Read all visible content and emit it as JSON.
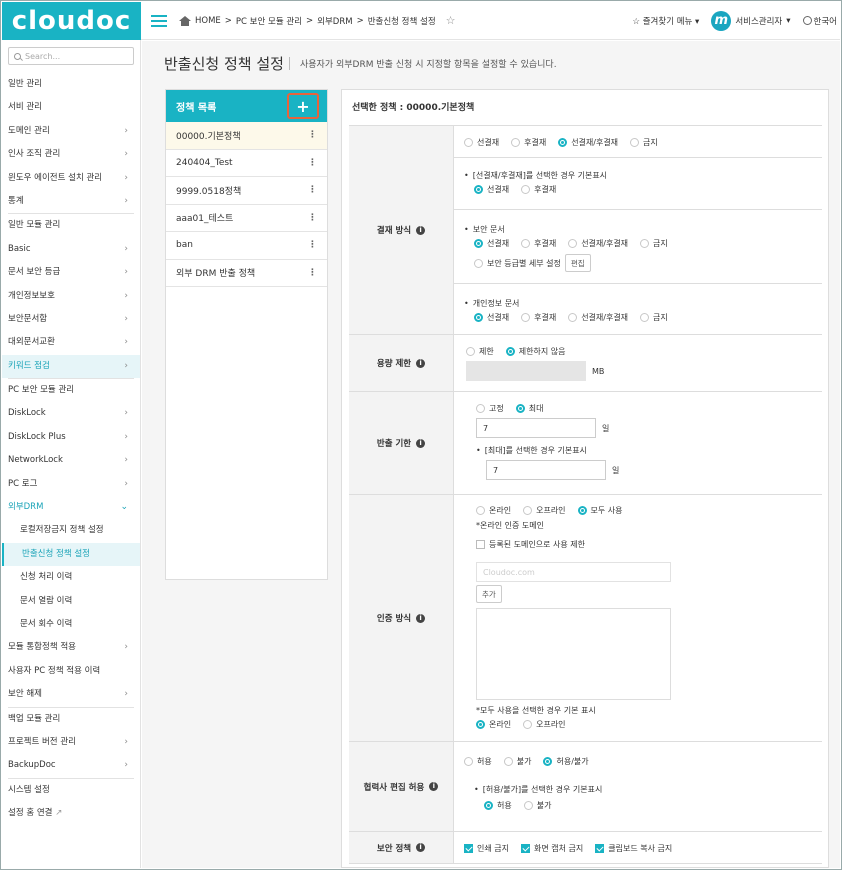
{
  "app": {
    "logo": "cloudoc"
  },
  "header": {
    "breadcrumb": [
      "HOME",
      ">",
      "PC 보안 모듈 관리",
      ">",
      "외부DRM",
      ">",
      "반출신청 정책 설정"
    ],
    "favorites": "즐겨찾기 메뉴",
    "avatar_letter": "m",
    "user": "서비스관리자",
    "language": "한국어"
  },
  "sidebar": {
    "search_placeholder": "Search...",
    "sections": [
      {
        "title": "일반 관리",
        "items": [
          "서비 관리",
          "도메인 관리",
          "인사 조직 관리",
          "윈도우 에이전트 설치 관리",
          "통계"
        ]
      },
      {
        "title": "일반 모듈 관리",
        "items": [
          "Basic",
          "문서 보안 등급",
          "개인정보보호",
          "보안문서함",
          "대외문서교환",
          "키워드 점검"
        ]
      },
      {
        "title": "PC 보안 모듈 관리",
        "items": [
          "DiskLock",
          "DiskLock Plus",
          "NetworkLock",
          "PC 로그",
          "외부DRM"
        ],
        "subitems": [
          "로컬저장금지 정책 설정",
          "반출신청 정책 설정",
          "신청 처리 이력",
          "문서 열람 이력",
          "문서 회수 이력"
        ],
        "items_after": [
          "모듈 통합정책 적용",
          "사용자 PC 정책 적용 이력",
          "보안 해제"
        ]
      },
      {
        "title": "백업 모듈 관리",
        "items": [
          "프로젝트 버전 관리",
          "BackupDoc"
        ]
      },
      {
        "title": "시스템 설정",
        "items": [
          "설정 홈 연결"
        ]
      }
    ]
  },
  "page": {
    "title": "반출신청 정책 설정",
    "subtitle": "사용자가 외부DRM 반출 신청 시 지정할 항목을 설정할 수 있습니다."
  },
  "policy_list": {
    "header": "정책 목록",
    "add_icon": "+",
    "items": [
      "00000.기본정책",
      "240404_Test",
      "9999.0518정책",
      "aaa01_테스트",
      "ban",
      "외부 DRM 반출 정책"
    ]
  },
  "selected": {
    "label": "선택한 정책 : 00000.기본정책"
  },
  "form": {
    "payment": {
      "label": "결재 방식",
      "options": [
        "선결재",
        "후결재",
        "선결재/후결재",
        "금지"
      ],
      "default_label": "[선결재/후결재]를 선택한 경우 기본표시",
      "default_options": [
        "선결재",
        "후결재"
      ],
      "secure_doc": "보안 문서",
      "secure_options": [
        "선결재",
        "후결재",
        "선결재/후결재",
        "금지"
      ],
      "grade_setting": "보안 등급별 세부 설정",
      "edit": "편집",
      "privacy_doc": "개인정보 문서",
      "privacy_options": [
        "선결재",
        "후결재",
        "선결재/후결재",
        "금지"
      ]
    },
    "capacity": {
      "label": "용량 제한",
      "options": [
        "제한",
        "제한하지 않음"
      ],
      "unit": "MB"
    },
    "period": {
      "label": "반출 기한",
      "options": [
        "고정",
        "최대"
      ],
      "value": "7",
      "unit": "일",
      "default_label": "[최대]를 선택한 경우 기본표시",
      "default_value": "7"
    },
    "auth": {
      "label": "인증 방식",
      "options": [
        "온라인",
        "오프라인",
        "모두 사용"
      ],
      "domain_title": "*온라인 인증 도메인",
      "domain_check": "등록된 도메인으로 사용 제한",
      "domain_placeholder": "Cloudoc.com",
      "add": "추가",
      "default_label": "*모두 사용을 선택한 경우 기본 표시",
      "default_options": [
        "온라인",
        "오프라인"
      ]
    },
    "partner": {
      "label": "협력사 편집 허용",
      "options": [
        "허용",
        "불가",
        "허용/불가"
      ],
      "default_label": "[허용/불가]를 선택한 경우 기본표시",
      "default_options": [
        "허용",
        "불가"
      ]
    },
    "security": {
      "label": "보안 정책",
      "checks": [
        "인쇄 금지",
        "화면 캡처 금지",
        "클립보드 복사 금지"
      ]
    }
  }
}
